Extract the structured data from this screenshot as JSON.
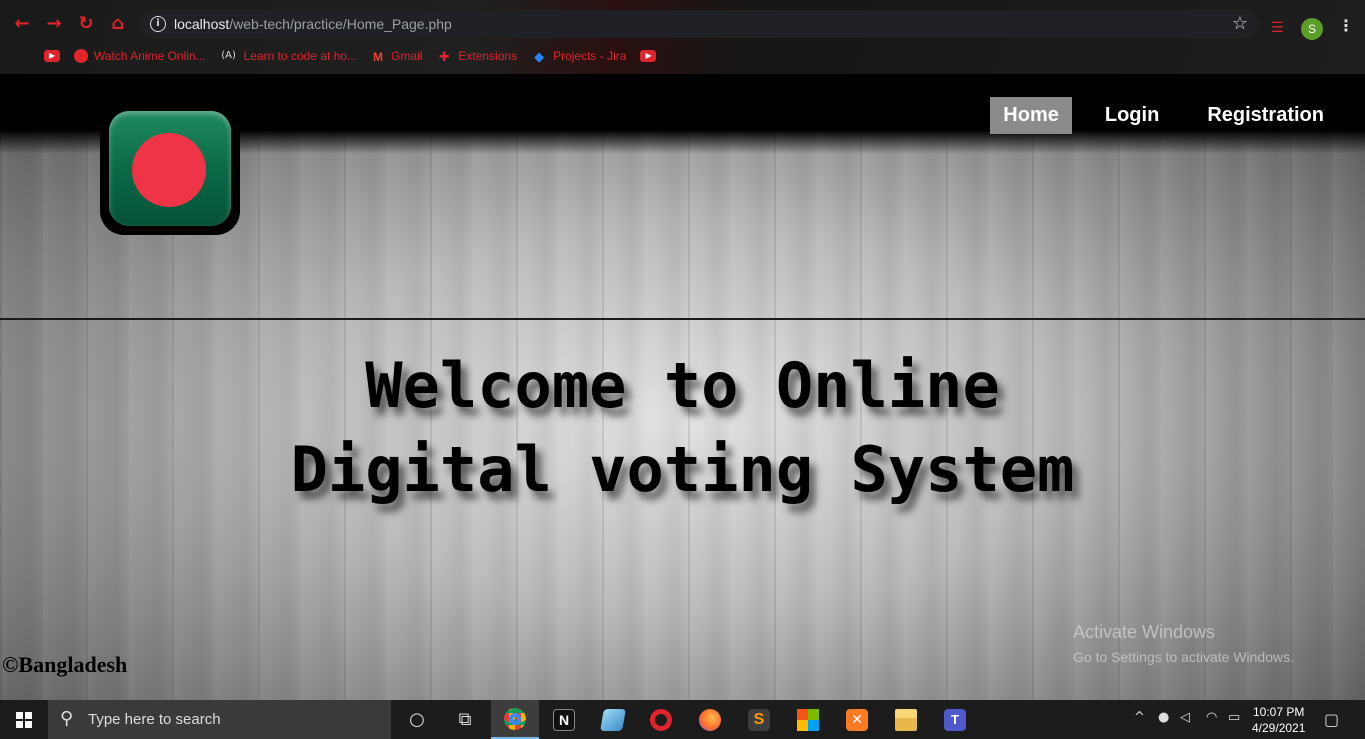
{
  "browser": {
    "url_host": "localhost",
    "url_path": "/web-tech/practice/Home_Page.php",
    "profile_initial": "S",
    "bookmarks": [
      {
        "label": "",
        "icon": "youtube-icon"
      },
      {
        "label": "Watch Anime Onlin...",
        "icon": "anime-icon"
      },
      {
        "label": "Learn to code at ho...",
        "icon": "freecodecamp-icon"
      },
      {
        "label": "Gmail",
        "icon": "gmail-icon"
      },
      {
        "label": "Extensions",
        "icon": "puzzle-icon"
      },
      {
        "label": "Projects - Jira",
        "icon": "jira-icon"
      },
      {
        "label": "",
        "icon": "youtube-icon"
      }
    ]
  },
  "site": {
    "nav": [
      {
        "label": "Home",
        "active": true
      },
      {
        "label": "Login",
        "active": false
      },
      {
        "label": "Registration",
        "active": false
      }
    ],
    "headline_line1": "Welcome to Online",
    "headline_line2": "Digital voting System",
    "footer": "©Bangladesh",
    "colors": {
      "flag_green": "#0b6a46",
      "flag_red": "#f03448",
      "nav_active": "#8b8b8b"
    }
  },
  "watermark": {
    "title": "Activate Windows",
    "subtitle": "Go to Settings to activate Windows."
  },
  "taskbar": {
    "search_placeholder": "Type here to search",
    "time": "10:07 PM",
    "date": "4/29/2021"
  }
}
